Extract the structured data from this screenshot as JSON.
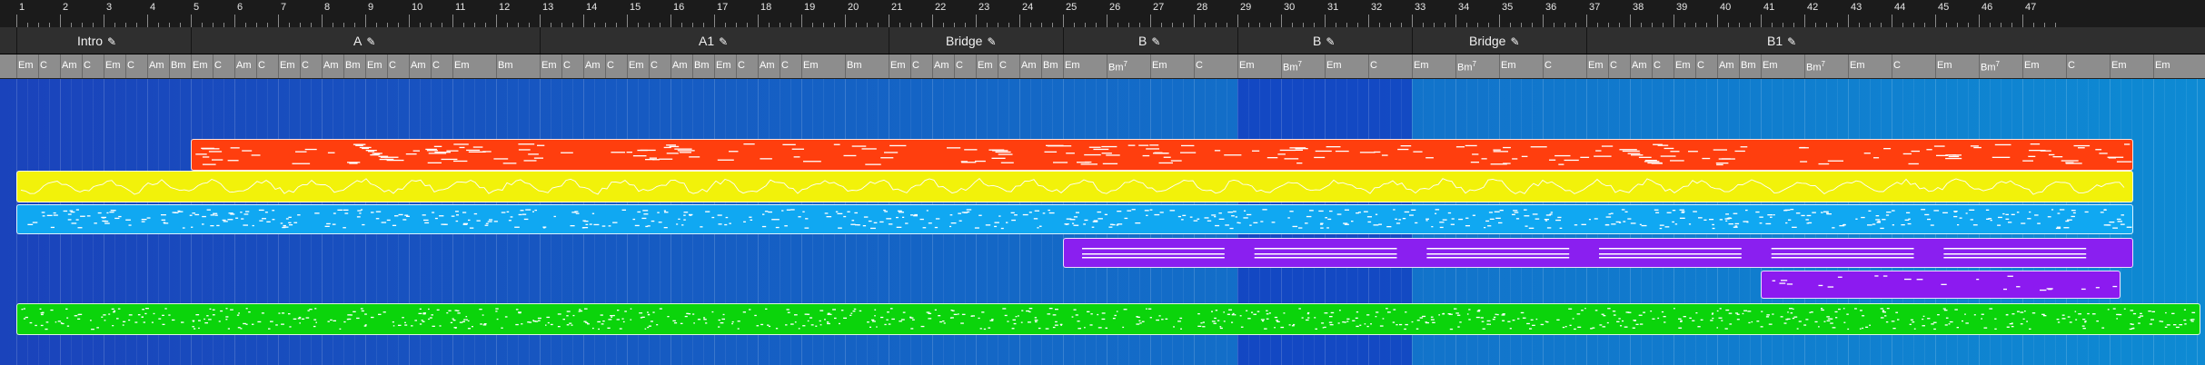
{
  "ruler": {
    "bars": [
      "1",
      "2",
      "3",
      "4",
      "5",
      "6",
      "7",
      "8",
      "9",
      "10",
      "11",
      "12",
      "13",
      "14",
      "15",
      "16",
      "17",
      "18",
      "19",
      "20",
      "21",
      "22",
      "23",
      "24",
      "25",
      "26",
      "27",
      "28",
      "29",
      "30",
      "31",
      "32",
      "33",
      "34",
      "35",
      "36",
      "37",
      "38",
      "39",
      "40",
      "41",
      "42",
      "43",
      "44",
      "45",
      "46",
      "47"
    ]
  },
  "sections": [
    {
      "label": "Intro",
      "start": 1,
      "end": 5
    },
    {
      "label": "A",
      "start": 5,
      "end": 13
    },
    {
      "label": "A1",
      "start": 13,
      "end": 21
    },
    {
      "label": "Bridge",
      "start": 21,
      "end": 25
    },
    {
      "label": "B",
      "start": 25,
      "end": 29
    },
    {
      "label": "B",
      "start": 29,
      "end": 33
    },
    {
      "label": "Bridge",
      "start": 33,
      "end": 37
    },
    {
      "label": "B1",
      "start": 37,
      "end": 46
    }
  ],
  "section_icon": "guitar-icon",
  "chords": [
    {
      "name": "Em",
      "sup": "",
      "at": 1
    },
    {
      "name": "C",
      "sup": "",
      "at": 1.5
    },
    {
      "name": "Am",
      "sup": "",
      "at": 2
    },
    {
      "name": "C",
      "sup": "",
      "at": 2.5
    },
    {
      "name": "Em",
      "sup": "",
      "at": 3
    },
    {
      "name": "C",
      "sup": "",
      "at": 3.5
    },
    {
      "name": "Am",
      "sup": "",
      "at": 4
    },
    {
      "name": "Bm",
      "sup": "",
      "at": 4.5
    },
    {
      "name": "Em",
      "sup": "",
      "at": 5
    },
    {
      "name": "C",
      "sup": "",
      "at": 5.5
    },
    {
      "name": "Am",
      "sup": "",
      "at": 6
    },
    {
      "name": "C",
      "sup": "",
      "at": 6.5
    },
    {
      "name": "Em",
      "sup": "",
      "at": 7
    },
    {
      "name": "C",
      "sup": "",
      "at": 7.5
    },
    {
      "name": "Am",
      "sup": "",
      "at": 8
    },
    {
      "name": "Bm",
      "sup": "",
      "at": 8.5
    },
    {
      "name": "Em",
      "sup": "",
      "at": 9
    },
    {
      "name": "C",
      "sup": "",
      "at": 9.5
    },
    {
      "name": "Am",
      "sup": "",
      "at": 10
    },
    {
      "name": "C",
      "sup": "",
      "at": 10.5
    },
    {
      "name": "Em",
      "sup": "",
      "at": 11
    },
    {
      "name": "Bm",
      "sup": "",
      "at": 12
    },
    {
      "name": "Em",
      "sup": "",
      "at": 13
    },
    {
      "name": "C",
      "sup": "",
      "at": 13.5
    },
    {
      "name": "Am",
      "sup": "",
      "at": 14
    },
    {
      "name": "C",
      "sup": "",
      "at": 14.5
    },
    {
      "name": "Em",
      "sup": "",
      "at": 15
    },
    {
      "name": "C",
      "sup": "",
      "at": 15.5
    },
    {
      "name": "Am",
      "sup": "",
      "at": 16
    },
    {
      "name": "Bm",
      "sup": "",
      "at": 16.5
    },
    {
      "name": "Em",
      "sup": "",
      "at": 17
    },
    {
      "name": "C",
      "sup": "",
      "at": 17.5
    },
    {
      "name": "Am",
      "sup": "",
      "at": 18
    },
    {
      "name": "C",
      "sup": "",
      "at": 18.5
    },
    {
      "name": "Em",
      "sup": "",
      "at": 19
    },
    {
      "name": "Bm",
      "sup": "",
      "at": 20
    },
    {
      "name": "Em",
      "sup": "",
      "at": 21
    },
    {
      "name": "C",
      "sup": "",
      "at": 21.5
    },
    {
      "name": "Am",
      "sup": "",
      "at": 22
    },
    {
      "name": "C",
      "sup": "",
      "at": 22.5
    },
    {
      "name": "Em",
      "sup": "",
      "at": 23
    },
    {
      "name": "C",
      "sup": "",
      "at": 23.5
    },
    {
      "name": "Am",
      "sup": "",
      "at": 24
    },
    {
      "name": "Bm",
      "sup": "",
      "at": 24.5
    },
    {
      "name": "Em",
      "sup": "",
      "at": 25
    },
    {
      "name": "Bm",
      "sup": "7",
      "at": 26
    },
    {
      "name": "Em",
      "sup": "",
      "at": 27
    },
    {
      "name": "C",
      "sup": "",
      "at": 28
    },
    {
      "name": "Em",
      "sup": "",
      "at": 29
    },
    {
      "name": "Bm",
      "sup": "7",
      "at": 30
    },
    {
      "name": "Em",
      "sup": "",
      "at": 31
    },
    {
      "name": "C",
      "sup": "",
      "at": 32
    },
    {
      "name": "Em",
      "sup": "",
      "at": 33
    },
    {
      "name": "Bm",
      "sup": "7",
      "at": 34
    },
    {
      "name": "Em",
      "sup": "",
      "at": 35
    },
    {
      "name": "C",
      "sup": "",
      "at": 36
    },
    {
      "name": "Em",
      "sup": "",
      "at": 37
    },
    {
      "name": "C",
      "sup": "",
      "at": 37.5
    },
    {
      "name": "Am",
      "sup": "",
      "at": 38
    },
    {
      "name": "C",
      "sup": "",
      "at": 38.5
    },
    {
      "name": "Em",
      "sup": "",
      "at": 39
    },
    {
      "name": "C",
      "sup": "",
      "at": 39.5
    },
    {
      "name": "Am",
      "sup": "",
      "at": 40
    },
    {
      "name": "Bm",
      "sup": "",
      "at": 40.5
    },
    {
      "name": "Em",
      "sup": "",
      "at": 41
    },
    {
      "name": "Bm",
      "sup": "7",
      "at": 42
    },
    {
      "name": "Em",
      "sup": "",
      "at": 43
    },
    {
      "name": "C",
      "sup": "",
      "at": 44
    },
    {
      "name": "Em",
      "sup": "",
      "at": 45
    },
    {
      "name": "Bm",
      "sup": "7",
      "at": 46
    },
    {
      "name": "Em",
      "sup": "",
      "at": 47
    },
    {
      "name": "C",
      "sup": "",
      "at": 48
    },
    {
      "name": "Em",
      "sup": "",
      "at": 49
    },
    {
      "name": "Em",
      "sup": "",
      "at": 50
    }
  ],
  "tracks": [
    {
      "name": "orange-lead",
      "color": "#ff3e0e",
      "lane": 0,
      "start": 5,
      "end": 49.5,
      "pattern": "lead"
    },
    {
      "name": "yellow-arp",
      "color": "#f2f20a",
      "lane": 1,
      "start": 1,
      "end": 49.5,
      "pattern": "zigzag"
    },
    {
      "name": "cyan-bass",
      "color": "#10a8f2",
      "lane": 2,
      "start": 1,
      "end": 49.5,
      "pattern": "dense"
    },
    {
      "name": "purple-pad",
      "color": "#8a1ff0",
      "lane": 3,
      "start": 25,
      "end": 49.5,
      "pattern": "pad"
    },
    {
      "name": "violet-bells",
      "color": "#8c1af0",
      "lane": 4,
      "start": 41,
      "end": 49.2,
      "pattern": "sparse"
    },
    {
      "name": "green-drums",
      "color": "#0bd40b",
      "lane": 5,
      "start": 1,
      "end": 51.5,
      "pattern": "drums"
    }
  ],
  "highlight_region": {
    "start": 29,
    "end": 33
  }
}
